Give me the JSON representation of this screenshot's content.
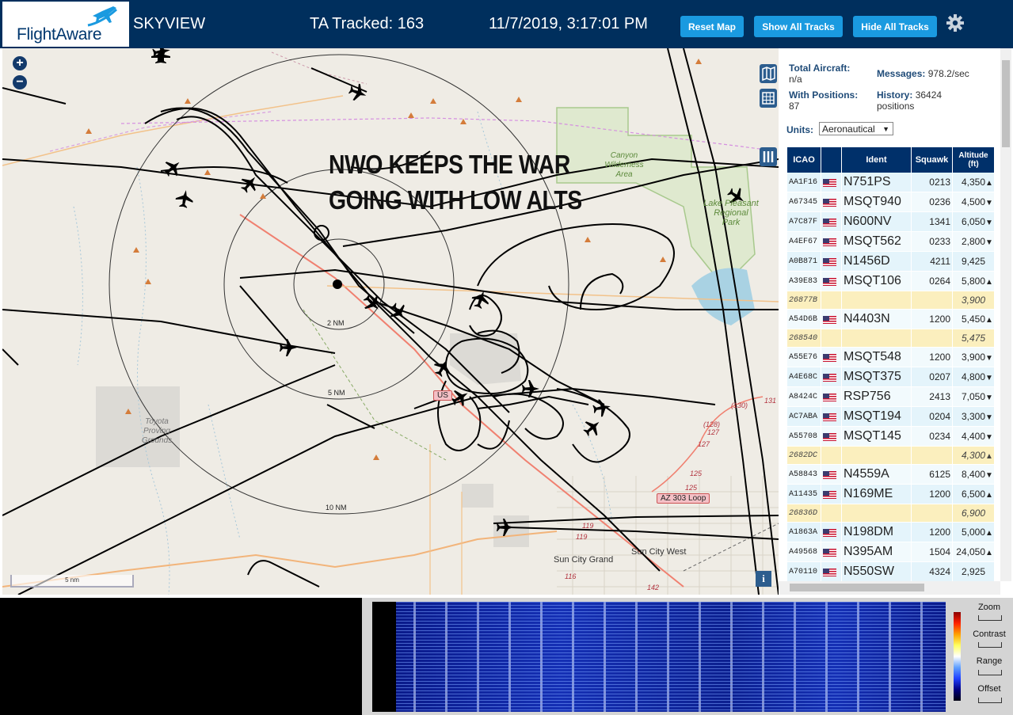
{
  "header": {
    "logo_text": "FlightAware",
    "app_name": "SKYVIEW",
    "tracked_label": "TA Tracked: 163",
    "datetime": "11/7/2019, 3:17:01 PM",
    "buttons": {
      "reset_map": "Reset Map",
      "show_all": "Show All Tracks",
      "hide_all": "Hide All Tracks"
    }
  },
  "map": {
    "caption_line1": "NWO KEEPS THE WAR",
    "caption_line2": "GOING WITH LOW ALTS",
    "zoom_in": "+",
    "zoom_out": "−",
    "scale": "5 nm",
    "info": "i",
    "range_labels": [
      "2 NM",
      "5 NM",
      "10 NM"
    ],
    "places": {
      "lake_pleasant": "Lake Pleasant\nRegional\nPark",
      "toyota": "Toyota\nProving\nGrounds",
      "sun_city_grand": "Sun City Grand",
      "sun_city_west": "Sun City West",
      "canyon": "Canyon\nWilderness\nArea"
    },
    "hwy_labels": [
      "AZ 303 Loop",
      "US"
    ],
    "route_numbers": [
      "(130)",
      "(128)",
      "127",
      "127",
      "125",
      "125",
      "119",
      "119",
      "116",
      "142",
      "131"
    ]
  },
  "stats": {
    "total_label": "Total Aircraft:",
    "total_value": "n/a",
    "positions_label": "With Positions:",
    "positions_value": "87",
    "messages_label": "Messages:",
    "messages_value": "978.2/sec",
    "history_label": "History:",
    "history_value": "36424",
    "history_unit": "positions",
    "units_label": "Units:",
    "units_value": "Aeronautical"
  },
  "table": {
    "headers": [
      "ICAO",
      "",
      "Ident",
      "Squawk",
      "Altitude (ft)"
    ],
    "rows": [
      {
        "icao": "AA1F16",
        "flag": true,
        "ident": "N751PS",
        "squawk": "0213",
        "alt": "4,350",
        "trend": "▲",
        "mlat": false
      },
      {
        "icao": "A67345",
        "flag": true,
        "ident": "MSQT940",
        "squawk": "0236",
        "alt": "4,500",
        "trend": "▼",
        "mlat": false
      },
      {
        "icao": "A7C87F",
        "flag": true,
        "ident": "N600NV",
        "squawk": "1341",
        "alt": "6,050",
        "trend": "▼",
        "mlat": false
      },
      {
        "icao": "A4EF67",
        "flag": true,
        "ident": "MSQT562",
        "squawk": "0233",
        "alt": "2,800",
        "trend": "▼",
        "mlat": false
      },
      {
        "icao": "A0B871",
        "flag": true,
        "ident": "N1456D",
        "squawk": "4211",
        "alt": "9,425",
        "trend": "",
        "mlat": false
      },
      {
        "icao": "A39E83",
        "flag": true,
        "ident": "MSQT106",
        "squawk": "0264",
        "alt": "5,800",
        "trend": "▲",
        "mlat": false
      },
      {
        "icao": "26877B",
        "flag": false,
        "ident": "",
        "squawk": "",
        "alt": "3,900",
        "trend": "",
        "mlat": true
      },
      {
        "icao": "A54D6B",
        "flag": true,
        "ident": "N4403N",
        "squawk": "1200",
        "alt": "5,450",
        "trend": "▲",
        "mlat": false
      },
      {
        "icao": "268540",
        "flag": false,
        "ident": "",
        "squawk": "",
        "alt": "5,475",
        "trend": "",
        "mlat": true
      },
      {
        "icao": "A55E76",
        "flag": true,
        "ident": "MSQT548",
        "squawk": "1200",
        "alt": "3,900",
        "trend": "▼",
        "mlat": false
      },
      {
        "icao": "A4E68C",
        "flag": true,
        "ident": "MSQT375",
        "squawk": "0207",
        "alt": "4,800",
        "trend": "▼",
        "mlat": false
      },
      {
        "icao": "A8424C",
        "flag": true,
        "ident": "RSP756",
        "squawk": "2413",
        "alt": "7,050",
        "trend": "▼",
        "mlat": false
      },
      {
        "icao": "AC7ABA",
        "flag": true,
        "ident": "MSQT194",
        "squawk": "0204",
        "alt": "3,300",
        "trend": "▼",
        "mlat": false
      },
      {
        "icao": "A55708",
        "flag": true,
        "ident": "MSQT145",
        "squawk": "0234",
        "alt": "4,400",
        "trend": "▼",
        "mlat": false
      },
      {
        "icao": "2682DC",
        "flag": false,
        "ident": "",
        "squawk": "",
        "alt": "4,300",
        "trend": "▲",
        "mlat": true
      },
      {
        "icao": "A58843",
        "flag": true,
        "ident": "N4559A",
        "squawk": "6125",
        "alt": "8,400",
        "trend": "▼",
        "mlat": false
      },
      {
        "icao": "A11435",
        "flag": true,
        "ident": "N169ME",
        "squawk": "1200",
        "alt": "6,500",
        "trend": "▲",
        "mlat": false
      },
      {
        "icao": "26836D",
        "flag": false,
        "ident": "",
        "squawk": "",
        "alt": "6,900",
        "trend": "",
        "mlat": true
      },
      {
        "icao": "A1863A",
        "flag": true,
        "ident": "N198DM",
        "squawk": "1200",
        "alt": "5,000",
        "trend": "▲",
        "mlat": false
      },
      {
        "icao": "A49568",
        "flag": true,
        "ident": "N395AM",
        "squawk": "1504",
        "alt": "24,050",
        "trend": "▲",
        "mlat": false
      },
      {
        "icao": "A70110",
        "flag": true,
        "ident": "N550SW",
        "squawk": "4324",
        "alt": "2,925",
        "trend": "",
        "mlat": false
      }
    ]
  },
  "spectrum": {
    "controls": [
      "Zoom",
      "Contrast",
      "Range",
      "Offset"
    ]
  }
}
